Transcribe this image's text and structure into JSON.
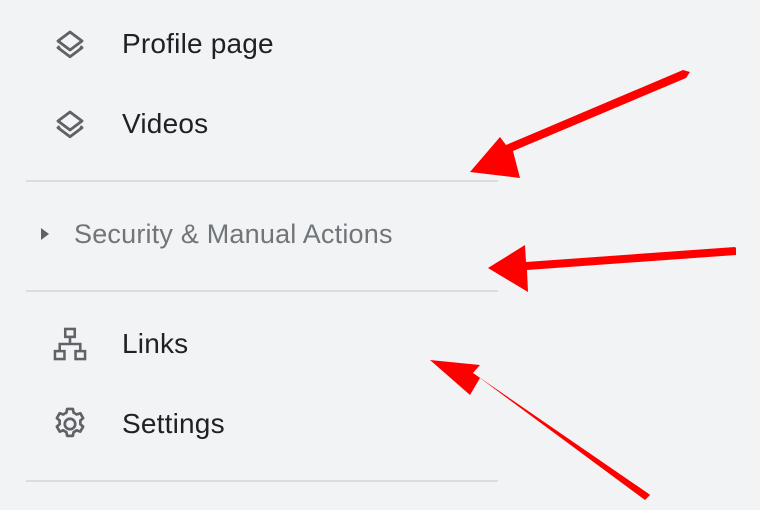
{
  "nav": {
    "items": [
      {
        "label": "Profile page",
        "icon": "layers-icon"
      },
      {
        "label": "Videos",
        "icon": "layers-icon"
      }
    ],
    "section": {
      "label": "Security & Manual Actions",
      "icon": "caret-right-icon",
      "expanded": false
    },
    "more_items": [
      {
        "label": "Links",
        "icon": "sitemap-icon"
      },
      {
        "label": "Settings",
        "icon": "gear-icon"
      }
    ]
  },
  "annotations": {
    "arrow_color": "#ff0000",
    "arrow_count": 3
  },
  "colors": {
    "background": "#f1f3f4",
    "label": "#202124",
    "muted_label": "#70757a",
    "icon": "#5f6368",
    "divider": "#dadce0"
  }
}
